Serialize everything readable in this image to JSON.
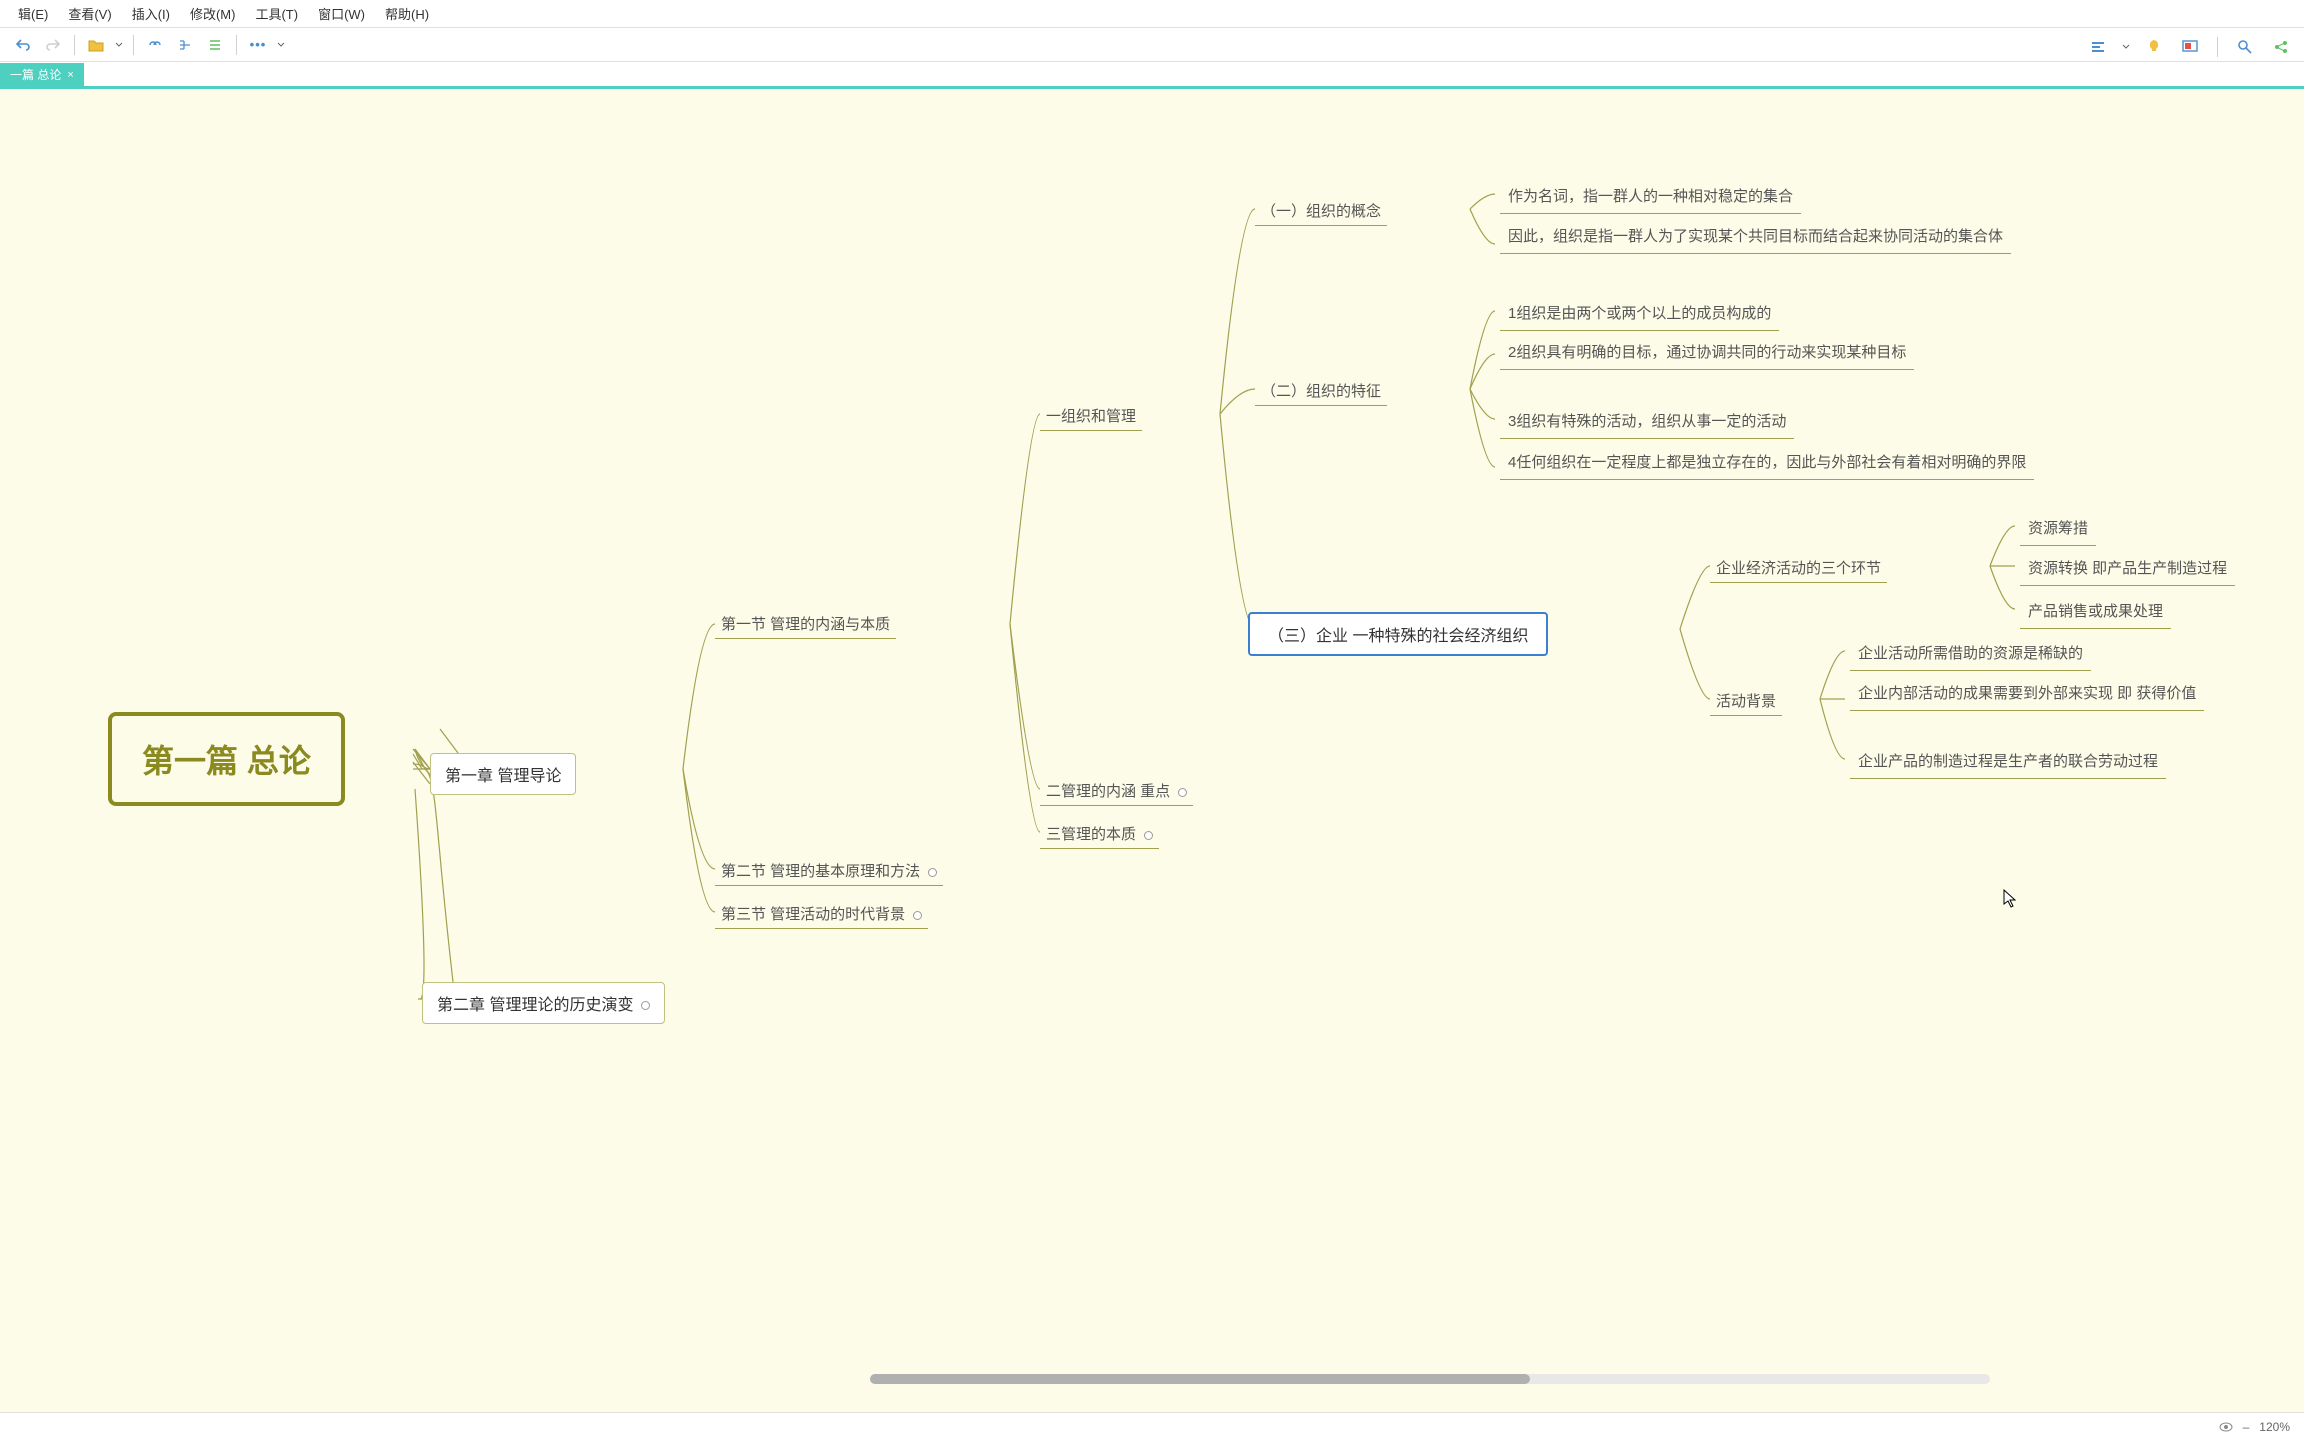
{
  "menu": {
    "edit": "辑(E)",
    "view": "查看(V)",
    "insert": "插入(I)",
    "modify": "修改(M)",
    "tools": "工具(T)",
    "window": "窗口(W)",
    "help": "帮助(H)"
  },
  "tab": {
    "title": "一篇 总论",
    "close": "×"
  },
  "status": {
    "zoom": "120%",
    "minus": "–"
  },
  "mm": {
    "root": "第一篇 总论",
    "ch1": "第一章 管理导论",
    "ch2": "第二章 管理理论的历史演变",
    "s1": "第一节 管理的内涵与本质",
    "s2": "第二节 管理的基本原理和方法",
    "s3": "第三节 管理活动的时代背景",
    "t1": "一组织和管理",
    "t2": "二管理的内涵 重点",
    "t3": "三管理的本质",
    "p1": "（一）组织的概念",
    "p2": "（二）组织的特征",
    "p3": "（三）企业 一种特殊的社会经济组织",
    "l1a": "作为名词，指一群人的一种相对稳定的集合",
    "l1b": "因此，组织是指一群人为了实现某个共同目标而结合起来协同活动的集合体",
    "l2a": "1组织是由两个或两个以上的成员构成的",
    "l2b": "2组织具有明确的目标，通过协调共同的行动来实现某种目标",
    "l2c": "3组织有特殊的活动，组织从事一定的活动",
    "l2d": "4任何组织在一定程度上都是独立存在的，因此与外部社会有着相对明确的界限",
    "q1": "企业经济活动的三个环节",
    "q1a": "资源筹措",
    "q1b": "资源转换 即产品生产制造过程",
    "q1c": "产品销售或成果处理",
    "q2": "活动背景",
    "q2a": "企业活动所需借助的资源是稀缺的",
    "q2b": "企业内部活动的成果需要到外部来实现 即 获得价值",
    "q2c": "企业产品的制造过程是生产者的联合劳动过程"
  }
}
